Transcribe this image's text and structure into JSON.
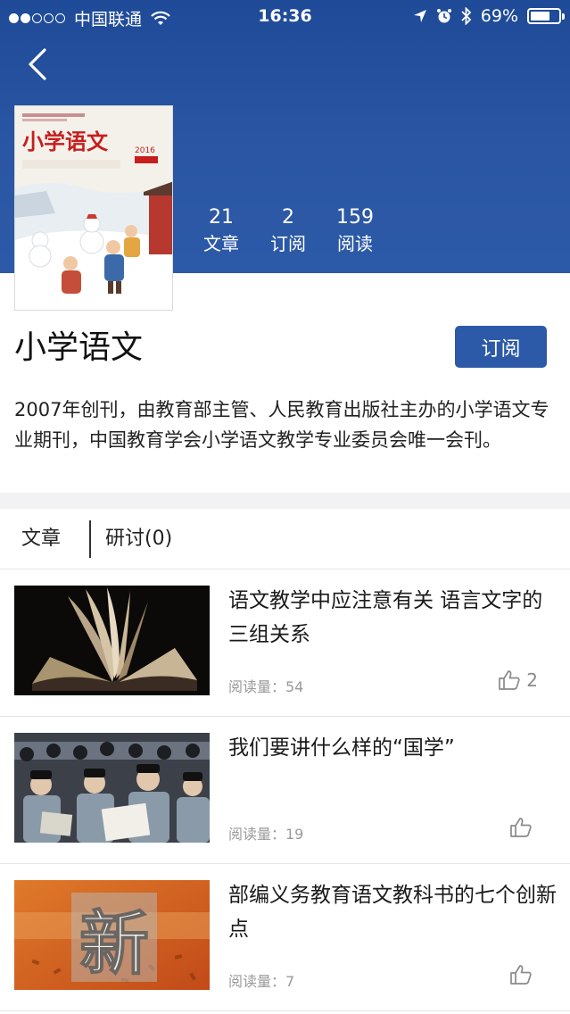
{
  "status_bar": {
    "carrier": "中国联通",
    "time": "16:36",
    "battery": "69%",
    "battery_level": 0.69,
    "signal_bars": 2,
    "icons": [
      "wifi-icon",
      "location-icon",
      "alarm-icon",
      "bluetooth-icon",
      "battery-icon"
    ]
  },
  "header": {
    "back_icon": "chevron-left-icon",
    "stats": [
      {
        "num": "21",
        "label": "文章"
      },
      {
        "num": "2",
        "label": "订阅"
      },
      {
        "num": "159",
        "label": "阅读"
      }
    ]
  },
  "magazine": {
    "cover_title": "小学语文",
    "cover_year": "2016",
    "title": "小学语文",
    "subscribe_label": "订阅",
    "description": "2007年创刊，由教育部主管、人民教育出版社主办的小学语文专业期刊，中国教育学会小学语文教学专业委员会唯一会刊。"
  },
  "tabs": [
    {
      "label": "文章"
    },
    {
      "label": "研讨(0)"
    }
  ],
  "articles": [
    {
      "title": "语文教学中应注意有关 语言文字的三组关系",
      "meta": "阅读量：54",
      "likes": "2"
    },
    {
      "title": "我们要讲什么样的“国学”",
      "meta": "阅读量：19",
      "likes": ""
    },
    {
      "title": "部编义务教育语文教科书的七个创新点",
      "meta": "阅读量：7",
      "likes": "",
      "thumb_text": "新"
    }
  ],
  "colors": {
    "brand": "#2d5aa8",
    "header_top": "#1e4a98",
    "muted_text": "#9a9a9a",
    "section_gap": "#f2f2f4"
  }
}
